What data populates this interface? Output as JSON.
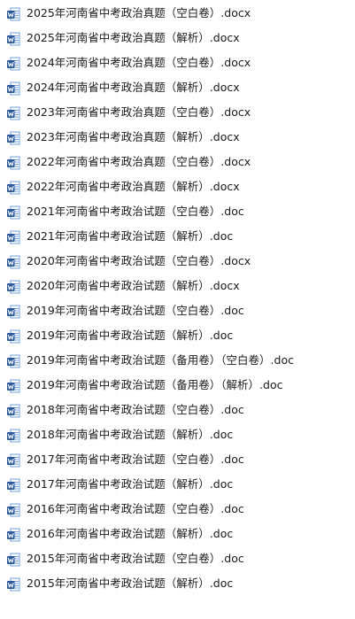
{
  "file_icon": "word-document-icon",
  "colors": {
    "icon_blue": "#2b579a",
    "icon_light": "#6f9ed8",
    "text": "#1a1a1a",
    "background": "#ffffff"
  },
  "files": [
    {
      "name": "2025年河南省中考政治真题（空白卷）.docx"
    },
    {
      "name": "2025年河南省中考政治真题（解析）.docx"
    },
    {
      "name": "2024年河南省中考政治真题（空白卷）.docx"
    },
    {
      "name": "2024年河南省中考政治真题（解析）.docx"
    },
    {
      "name": "2023年河南省中考政治真题（空白卷）.docx"
    },
    {
      "name": "2023年河南省中考政治真题（解析）.docx"
    },
    {
      "name": "2022年河南省中考政治真题（空白卷）.docx"
    },
    {
      "name": "2022年河南省中考政治真题（解析）.docx"
    },
    {
      "name": "2021年河南省中考政治试题（空白卷）.doc"
    },
    {
      "name": "2021年河南省中考政治试题（解析）.doc"
    },
    {
      "name": "2020年河南省中考政治试题（空白卷）.docx"
    },
    {
      "name": "2020年河南省中考政治试题（解析）.docx"
    },
    {
      "name": "2019年河南省中考政治试题（空白卷）.doc"
    },
    {
      "name": "2019年河南省中考政治试题（解析）.doc"
    },
    {
      "name": "2019年河南省中考政治试题（备用卷）（空白卷）.doc"
    },
    {
      "name": "2019年河南省中考政治试题（备用卷）（解析）.doc"
    },
    {
      "name": "2018年河南省中考政治试题（空白卷）.doc"
    },
    {
      "name": "2018年河南省中考政治试题（解析）.doc"
    },
    {
      "name": "2017年河南省中考政治试题（空白卷）.doc"
    },
    {
      "name": "2017年河南省中考政治试题（解析）.doc"
    },
    {
      "name": "2016年河南省中考政治试题（空白卷）.doc"
    },
    {
      "name": "2016年河南省中考政治试题（解析）.doc"
    },
    {
      "name": "2015年河南省中考政治试题（空白卷）.doc"
    },
    {
      "name": "2015年河南省中考政治试题（解析）.doc"
    }
  ]
}
